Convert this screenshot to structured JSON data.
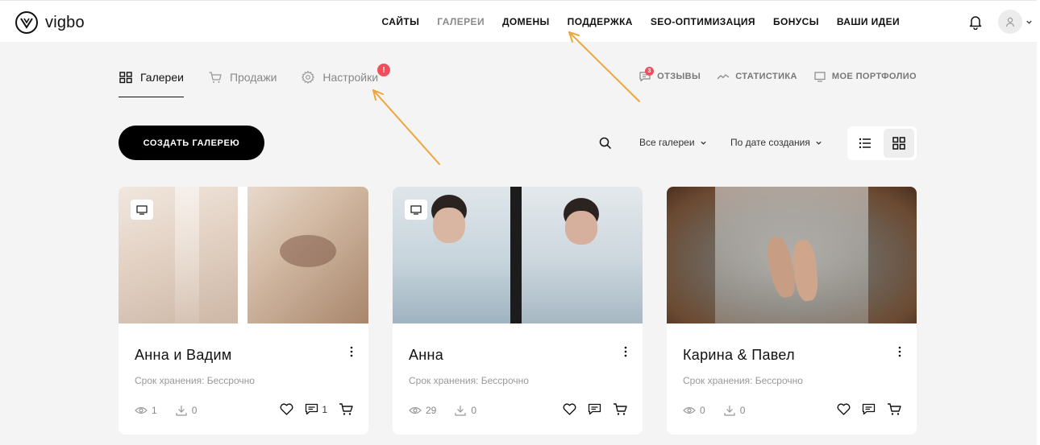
{
  "header": {
    "logo_text": "vigbo",
    "nav": [
      {
        "label": "САЙТЫ"
      },
      {
        "label": "ГАЛЕРЕИ",
        "active": true
      },
      {
        "label": "ДОМЕНЫ"
      },
      {
        "label": "ПОДДЕРЖКА"
      },
      {
        "label": "SEO-ОПТИМИЗАЦИЯ"
      },
      {
        "label": "БОНУСЫ"
      },
      {
        "label": "ВАШИ ИДЕИ"
      }
    ],
    "icons": [
      "bell-icon",
      "user-icon",
      "chevron-down-icon"
    ]
  },
  "subnav": {
    "tabs": [
      {
        "label": "Галереи",
        "icon": "grid-icon",
        "active": true
      },
      {
        "label": "Продажи",
        "icon": "cart-icon"
      },
      {
        "label": "Настройки",
        "icon": "gear-icon"
      }
    ],
    "settings_badge": "!",
    "right_links": [
      {
        "label": "ОТЗЫВЫ",
        "icon": "comment-icon",
        "badge": "3"
      },
      {
        "label": "СТАТИСТИКА",
        "icon": "stats-icon"
      },
      {
        "label": "МОЕ ПОРТФОЛИО",
        "icon": "monitor-icon"
      }
    ]
  },
  "toolbar": {
    "create_label": "СОЗДАТЬ ГАЛЕРЕЮ",
    "filter_galleries": "Все галереи",
    "sort_label": "По дате создания",
    "view_mode": "grid"
  },
  "cards": [
    {
      "title": "Анна и Вадим",
      "storage": "Срок хранения: Бессрочно",
      "views": "1",
      "downloads": "0",
      "comments": "1",
      "cover_colors": [
        "#e9ddd3",
        "#d9c4b2"
      ]
    },
    {
      "title": "Анна",
      "storage": "Срок хранения: Бессрочно",
      "views": "29",
      "downloads": "0",
      "comments": "",
      "cover_colors": [
        "#c9d5dc",
        "#bfcdd6"
      ]
    },
    {
      "title": "Карина & Павел",
      "storage": "Срок хранения: Бессрочно",
      "views": "0",
      "downloads": "0",
      "comments": "",
      "cover_colors": [
        "#7a5a44"
      ]
    }
  ],
  "colors": {
    "accent_arrow": "#f0a53c",
    "badge": "#f04e5a",
    "button": "#000000"
  }
}
